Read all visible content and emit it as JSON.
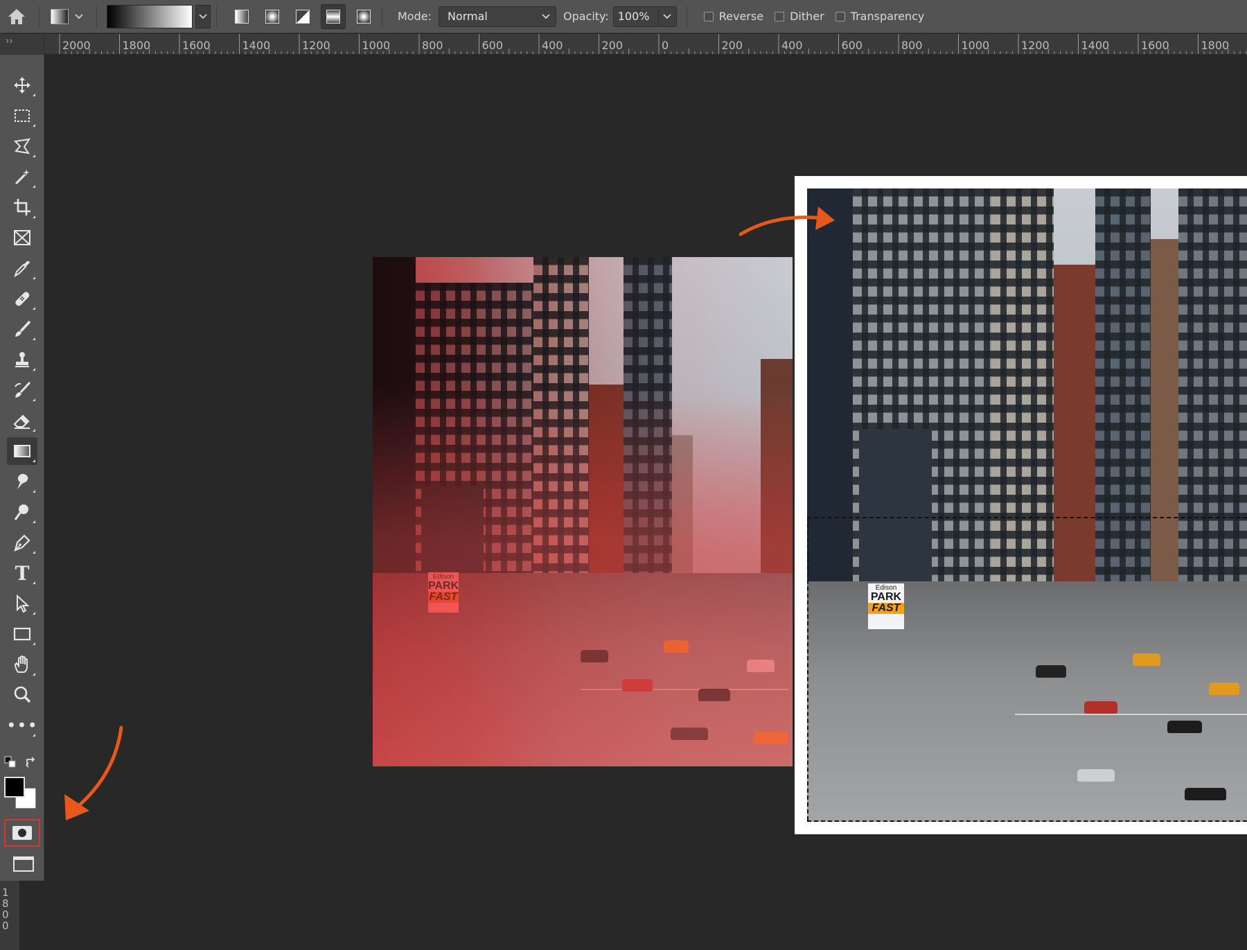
{
  "options_bar": {
    "mode_label": "Mode:",
    "mode_value": "Normal",
    "opacity_label": "Opacity:",
    "opacity_value": "100%",
    "reverse_label": "Reverse",
    "dither_label": "Dither",
    "transparency_label": "Transparency"
  },
  "ruler": {
    "corner_glyph": "››",
    "h_labels": [
      "2000",
      "1800",
      "1600",
      "1400",
      "1200",
      "1000",
      "800",
      "600",
      "400",
      "200",
      "0",
      "200",
      "400",
      "600",
      "800",
      "1000",
      "1200",
      "1400",
      "1600",
      "1800"
    ],
    "v_labels": [
      "1",
      "8",
      "0",
      "0"
    ]
  },
  "toolbar": {
    "tools": [
      {
        "name": "move-tool",
        "icon": "move-icon"
      },
      {
        "name": "rectangular-marquee-tool",
        "icon": "marquee-icon"
      },
      {
        "name": "lasso-tool",
        "icon": "lasso-icon"
      },
      {
        "name": "magic-wand-tool",
        "icon": "magic-wand-icon"
      },
      {
        "name": "crop-tool",
        "icon": "crop-icon"
      },
      {
        "name": "frame-tool",
        "icon": "frame-icon"
      },
      {
        "name": "eyedropper-tool",
        "icon": "eyedropper-icon"
      },
      {
        "name": "healing-brush-tool",
        "icon": "bandage-icon"
      },
      {
        "name": "brush-tool",
        "icon": "brush-icon"
      },
      {
        "name": "clone-stamp-tool",
        "icon": "stamp-icon"
      },
      {
        "name": "history-brush-tool",
        "icon": "history-brush-icon"
      },
      {
        "name": "eraser-tool",
        "icon": "eraser-icon"
      },
      {
        "name": "gradient-tool",
        "icon": "gradient-icon"
      },
      {
        "name": "smudge-tool",
        "icon": "smudge-icon"
      },
      {
        "name": "dodge-tool",
        "icon": "dodge-icon"
      },
      {
        "name": "pen-tool",
        "icon": "pen-icon"
      },
      {
        "name": "type-tool",
        "icon": "type-icon"
      },
      {
        "name": "path-selection-tool",
        "icon": "arrow-icon"
      },
      {
        "name": "rectangle-tool",
        "icon": "rectangle-icon"
      },
      {
        "name": "hand-tool",
        "icon": "hand-icon"
      },
      {
        "name": "zoom-tool",
        "icon": "zoom-icon"
      },
      {
        "name": "edit-toolbar",
        "icon": "more-icon"
      }
    ],
    "type_tool_glyph": "T",
    "more_glyph": "•••",
    "foreground_color": "#000000",
    "background_color": "#ffffff",
    "highlight_color": "#d9352b"
  },
  "canvas": {
    "annotation_color": "#e8571b",
    "sign": {
      "top": "Edison",
      "park": "PARK",
      "fast": "FAST"
    }
  }
}
